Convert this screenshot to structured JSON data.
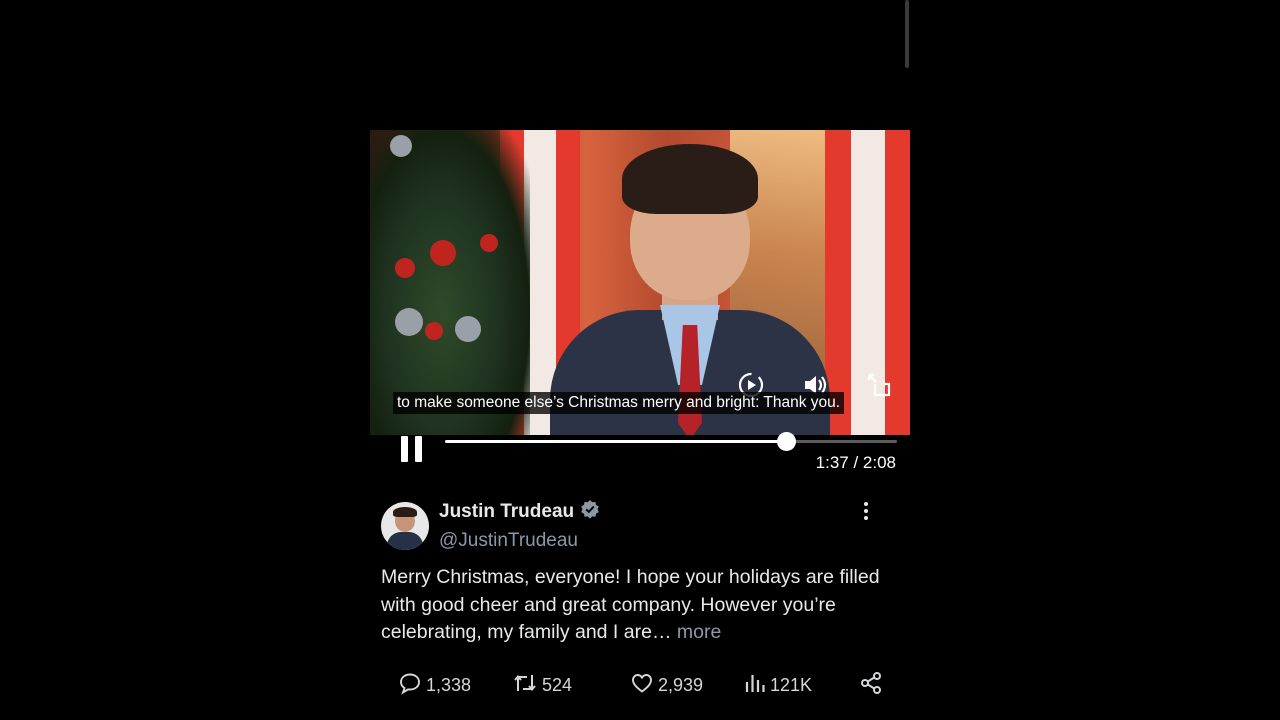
{
  "video": {
    "caption": "to make someone else’s Christmas merry and bright: Thank you.",
    "time": "1:37 / 2:08",
    "progress": 0.755
  },
  "tweet": {
    "author_name": "Justin Trudeau",
    "handle": "@JustinTrudeau",
    "body": "Merry Christmas, everyone! I hope your holidays are filled with good cheer and great company. However you’re celebrating, my family and I are…",
    "more_label": "more",
    "verified_color": "#8b98a5"
  },
  "actions": {
    "replies": "1,338",
    "retweets": "524",
    "likes": "2,939",
    "views": "121K"
  }
}
